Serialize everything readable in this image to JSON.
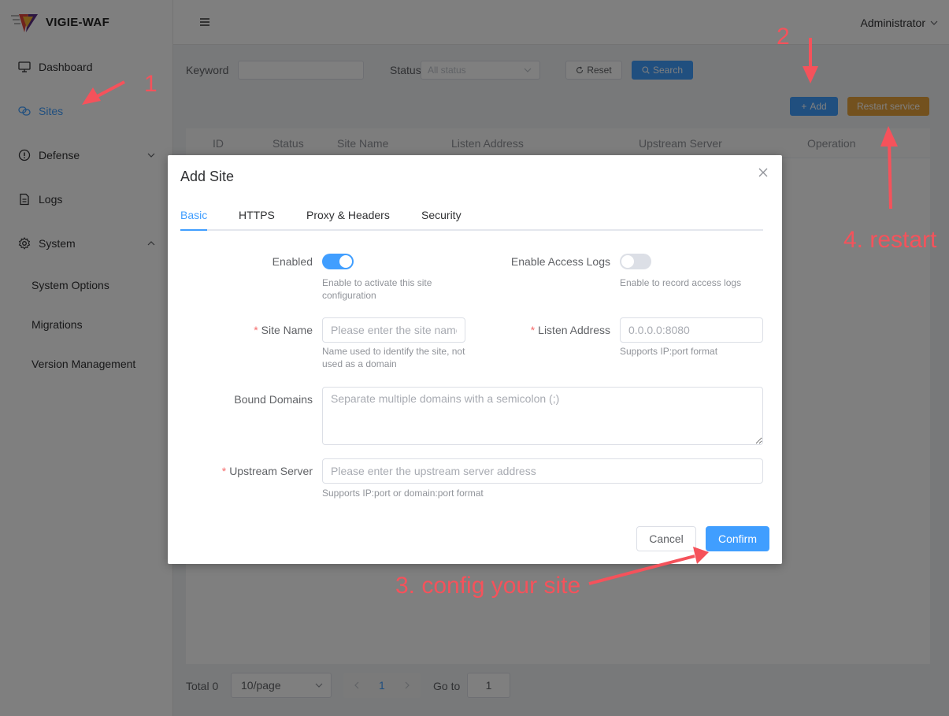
{
  "app": {
    "name": "VIGIE-WAF"
  },
  "header": {
    "user": "Administrator"
  },
  "sidebar": {
    "items": [
      {
        "label": "Dashboard"
      },
      {
        "label": "Sites"
      },
      {
        "label": "Defense"
      },
      {
        "label": "Logs"
      },
      {
        "label": "System"
      }
    ],
    "sub_items": [
      {
        "label": "System Options"
      },
      {
        "label": "Migrations"
      },
      {
        "label": "Version Management"
      }
    ]
  },
  "filter": {
    "keyword_label": "Keyword",
    "keyword_value": "",
    "status_label": "Status",
    "status_value": "All status",
    "reset_label": "Reset",
    "search_label": "Search"
  },
  "actions": {
    "add_label": "Add",
    "restart_label": "Restart service"
  },
  "table": {
    "columns": [
      "ID",
      "Status",
      "Site Name",
      "Listen Address",
      "Upstream Server",
      "Operation"
    ]
  },
  "pagination": {
    "total": "Total 0",
    "page_size": "10/page",
    "current_page": "1",
    "goto_label": "Go to",
    "goto_value": "1"
  },
  "dialog": {
    "title": "Add Site",
    "tabs": [
      "Basic",
      "HTTPS",
      "Proxy & Headers",
      "Security"
    ],
    "enabled_label": "Enabled",
    "enabled_value": true,
    "enabled_help": "Enable to activate this site configuration",
    "access_logs_label": "Enable Access Logs",
    "access_logs_value": false,
    "access_logs_help": "Enable to record access logs",
    "site_name_label": "Site Name",
    "site_name_placeholder": "Please enter the site name",
    "site_name_help": "Name used to identify the site, not used as a domain",
    "listen_label": "Listen Address",
    "listen_placeholder": "0.0.0.0:8080",
    "listen_help": "Supports IP:port format",
    "domains_label": "Bound Domains",
    "domains_placeholder": "Separate multiple domains with a semicolon (;)",
    "upstream_label": "Upstream Server",
    "upstream_placeholder": "Please enter the upstream server address",
    "upstream_help": "Supports IP:port or domain:port format",
    "cancel_label": "Cancel",
    "confirm_label": "Confirm"
  },
  "annotations": {
    "step1": "1",
    "step2": "2",
    "step3": "3. config your site",
    "step4": "4. restart"
  },
  "colors": {
    "primary": "#409eff",
    "warning": "#e6a23c",
    "annotation": "#f5525b",
    "required": "#f56c6c"
  }
}
